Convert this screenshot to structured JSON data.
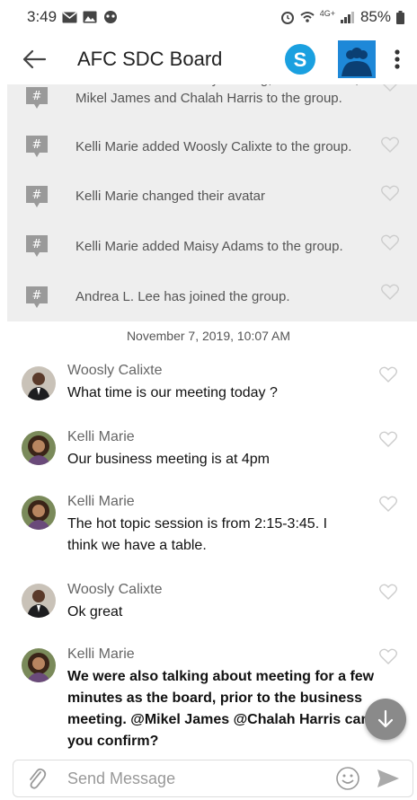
{
  "status_bar": {
    "time": "3:49",
    "battery": "85%",
    "network": "4G+"
  },
  "header": {
    "title": "AFC SDC Board"
  },
  "system_messages": [
    {
      "text": "Kelli Marie added Cathy Bartling, Sonia McNeil, Mikel James and Chalah Harris to the group."
    },
    {
      "text": "Kelli Marie added Woosly Calixte to the group."
    },
    {
      "text": "Kelli Marie changed their avatar"
    },
    {
      "text": "Kelli Marie added Maisy Adams to the group."
    },
    {
      "text": "Andrea L. Lee has joined the group."
    }
  ],
  "date_separator": "November 7, 2019, 10:07 AM",
  "messages": [
    {
      "author": "Woosly Calixte",
      "text": "What time is our meeting today ?",
      "avatar": "man"
    },
    {
      "author": "Kelli Marie",
      "text": "Our business meeting is at 4pm",
      "avatar": "woman"
    },
    {
      "author": "Kelli Marie",
      "text": "The hot topic session is from 2:15-3:45. I think we have a table.",
      "avatar": "woman"
    },
    {
      "author": "Woosly Calixte",
      "text": "Ok great",
      "avatar": "man"
    },
    {
      "author": "Kelli Marie",
      "text": "We were also talking about meeting for a few minutes as the board, prior to the business meeting. @Mikel James @Chalah Harris can you confirm?",
      "avatar": "woman"
    }
  ],
  "composer": {
    "placeholder": "Send Message"
  },
  "colors": {
    "skype_blue": "#1aa0e0",
    "group_blue": "#1e88d8",
    "fab_grey": "#8a8a8a",
    "panel_grey": "#eeeeee"
  }
}
